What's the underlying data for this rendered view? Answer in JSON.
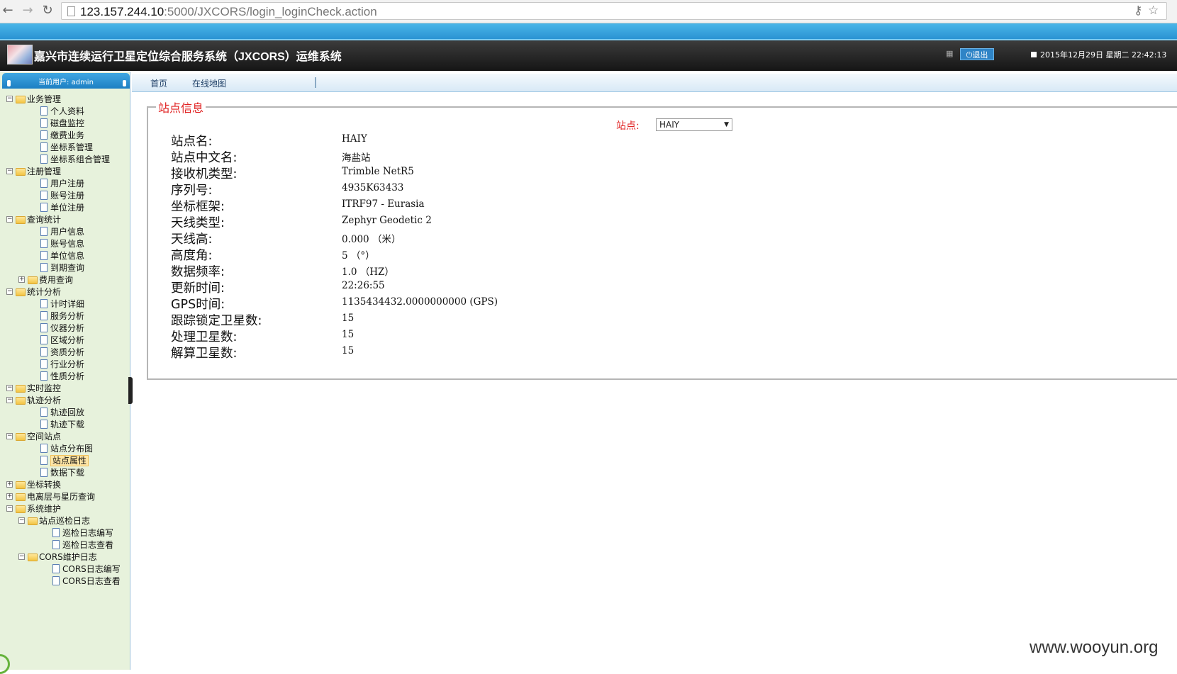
{
  "browser": {
    "url_host": "123.157.244.10",
    "url_path": ":5000/JXCORS/login_loginCheck.action"
  },
  "header": {
    "title": "嘉兴市连续运行卫星定位综合服务系统（JXCORS）运维系统",
    "logout_label": "退出",
    "datetime": "2015年12月29日 星期二 22:42:13"
  },
  "sidebar": {
    "current_user": "当前用户: admin",
    "tree": [
      {
        "label": "业务管理",
        "type": "folder",
        "level": 0,
        "expander": "−"
      },
      {
        "label": "个人资料",
        "type": "doc",
        "level": 1
      },
      {
        "label": "磁盘监控",
        "type": "doc",
        "level": 1
      },
      {
        "label": "缴费业务",
        "type": "doc",
        "level": 1
      },
      {
        "label": "坐标系管理",
        "type": "doc",
        "level": 1
      },
      {
        "label": "坐标系组合管理",
        "type": "doc",
        "level": 1
      },
      {
        "label": "注册管理",
        "type": "folder",
        "level": 0,
        "expander": "−"
      },
      {
        "label": "用户注册",
        "type": "doc",
        "level": 1
      },
      {
        "label": "账号注册",
        "type": "doc",
        "level": 1
      },
      {
        "label": "单位注册",
        "type": "doc",
        "level": 1
      },
      {
        "label": "查询统计",
        "type": "folder",
        "level": 0,
        "expander": "−"
      },
      {
        "label": "用户信息",
        "type": "doc",
        "level": 1
      },
      {
        "label": "账号信息",
        "type": "doc",
        "level": 1
      },
      {
        "label": "单位信息",
        "type": "doc",
        "level": 1
      },
      {
        "label": "到期查询",
        "type": "doc",
        "level": 1
      },
      {
        "label": "费用查询",
        "type": "folder",
        "level": 1,
        "expander": "+"
      },
      {
        "label": "统计分析",
        "type": "folder",
        "level": 0,
        "expander": "−"
      },
      {
        "label": "计时详细",
        "type": "doc",
        "level": 1
      },
      {
        "label": "服务分析",
        "type": "doc",
        "level": 1
      },
      {
        "label": "仪器分析",
        "type": "doc",
        "level": 1
      },
      {
        "label": "区域分析",
        "type": "doc",
        "level": 1
      },
      {
        "label": "资质分析",
        "type": "doc",
        "level": 1
      },
      {
        "label": "行业分析",
        "type": "doc",
        "level": 1
      },
      {
        "label": "性质分析",
        "type": "doc",
        "level": 1
      },
      {
        "label": "实时监控",
        "type": "folder",
        "level": 0,
        "expander": "−"
      },
      {
        "label": "轨迹分析",
        "type": "folder",
        "level": 0,
        "expander": "−"
      },
      {
        "label": "轨迹回放",
        "type": "doc",
        "level": 1
      },
      {
        "label": "轨迹下载",
        "type": "doc",
        "level": 1
      },
      {
        "label": "空间站点",
        "type": "folder",
        "level": 0,
        "expander": "−"
      },
      {
        "label": "站点分布图",
        "type": "doc",
        "level": 1
      },
      {
        "label": "站点属性",
        "type": "doc",
        "level": 1,
        "selected": true
      },
      {
        "label": "数据下载",
        "type": "doc",
        "level": 1
      },
      {
        "label": "坐标转换",
        "type": "folder",
        "level": 0,
        "expander": "+"
      },
      {
        "label": "电离层与星历查询",
        "type": "folder",
        "level": 0,
        "expander": "+"
      },
      {
        "label": "系统维护",
        "type": "folder",
        "level": 0,
        "expander": "−"
      },
      {
        "label": "站点巡检日志",
        "type": "folder",
        "level": 1,
        "expander": "−"
      },
      {
        "label": "巡检日志编写",
        "type": "doc",
        "level": 2
      },
      {
        "label": "巡检日志查看",
        "type": "doc",
        "level": 2
      },
      {
        "label": "CORS维护日志",
        "type": "folder",
        "level": 1,
        "expander": "−"
      },
      {
        "label": "CORS日志编写",
        "type": "doc",
        "level": 2
      },
      {
        "label": "CORS日志查看",
        "type": "doc",
        "level": 2
      }
    ]
  },
  "tabs": [
    "首页",
    "在线地图"
  ],
  "main": {
    "legend": "站点信息",
    "station_label": "站点:",
    "station_selected": "HAIY",
    "fields": [
      {
        "label": "站点名:",
        "value": "HAIY"
      },
      {
        "label": "站点中文名:",
        "value": "海盐站"
      },
      {
        "label": "接收机类型:",
        "value": "Trimble NetR5"
      },
      {
        "label": "序列号:",
        "value": "4935K63433"
      },
      {
        "label": "坐标框架:",
        "value": "ITRF97 - Eurasia"
      },
      {
        "label": "天线类型:",
        "value": "Zephyr Geodetic 2"
      },
      {
        "label": "天线高:",
        "value": "0.000 （米）"
      },
      {
        "label": "高度角:",
        "value": "5 （°）"
      },
      {
        "label": "数据频率:",
        "value": "1.0 （HZ）"
      },
      {
        "label": "更新时间:",
        "value": "22:26:55"
      },
      {
        "label": "GPS时间:",
        "value": "1135434432.0000000000 (GPS)"
      },
      {
        "label": "跟踪锁定卫星数:",
        "value": "15"
      },
      {
        "label": "处理卫星数:",
        "value": "15"
      },
      {
        "label": "解算卫星数:",
        "value": "15"
      }
    ]
  },
  "watermark": "www.wooyun.org"
}
